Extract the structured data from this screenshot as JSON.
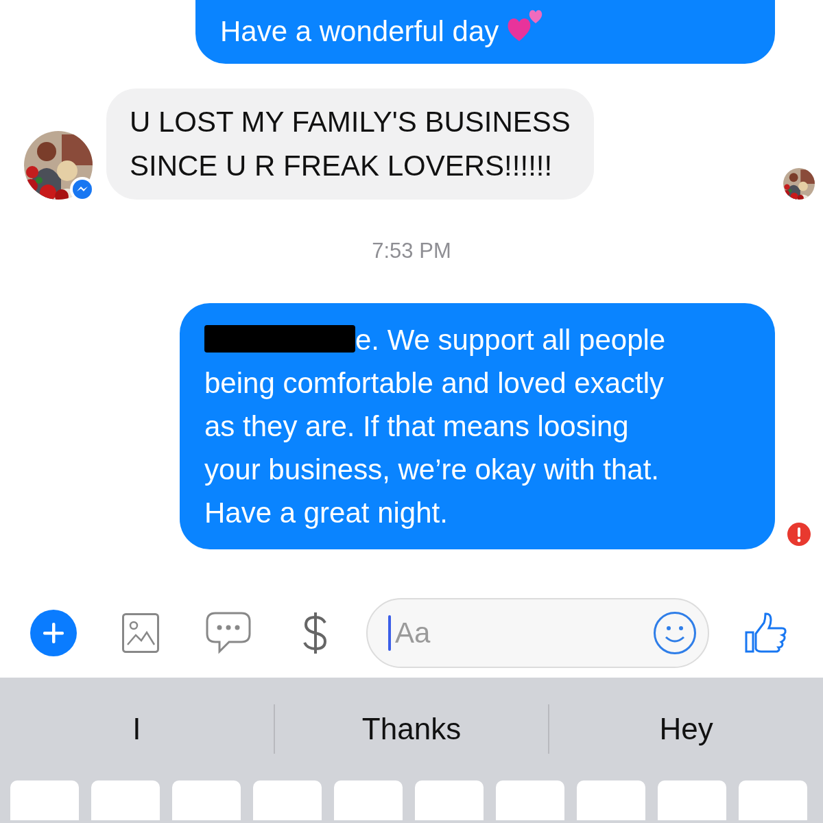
{
  "conversation": {
    "messages": [
      {
        "kind": "outgoing",
        "text": "Have a wonderful day",
        "has_emoji": true,
        "redacted": false,
        "failed": false
      },
      {
        "kind": "incoming",
        "text": "U LOST MY FAMILY'S BUSINESS\nSINCE U R FREAK LOVERS!!!!!!",
        "avatar": true,
        "read_receipt": true
      },
      {
        "kind": "timestamp",
        "text": "7:53 PM"
      },
      {
        "kind": "outgoing",
        "text": "e. We support all people\nbeing comfortable and loved exactly\nas they are. If that means loosing\nyour business, we’re okay with that.\nHave a great night.",
        "has_emoji": false,
        "redacted": true,
        "failed": true
      }
    ]
  },
  "composer": {
    "placeholder": "Aa"
  },
  "keyboard": {
    "suggestions": [
      "I",
      "Thanks",
      "Hey"
    ]
  }
}
